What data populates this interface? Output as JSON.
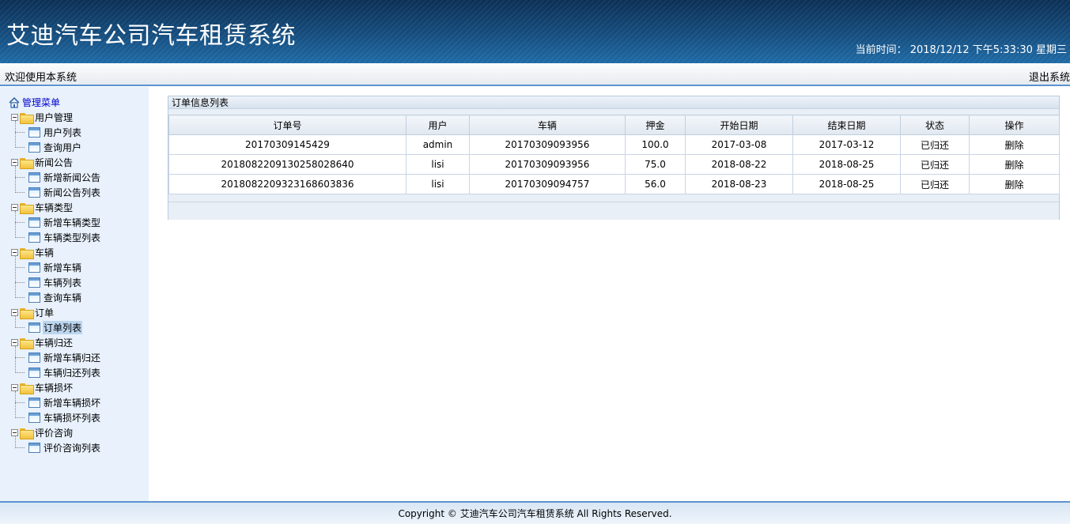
{
  "header": {
    "title": "艾迪汽车公司汽车租赁系统",
    "clock_label": "当前时间：",
    "clock_value": "2018/12/12 下午5:33:30 星期三"
  },
  "topbar": {
    "welcome": "欢迎使用本系统",
    "logout": "退出系统"
  },
  "sidebar": {
    "root_label": "管理菜单",
    "groups": [
      {
        "label": "用户管理",
        "items": [
          "用户列表",
          "查询用户"
        ]
      },
      {
        "label": "新闻公告",
        "items": [
          "新增新闻公告",
          "新闻公告列表"
        ]
      },
      {
        "label": "车辆类型",
        "items": [
          "新增车辆类型",
          "车辆类型列表"
        ]
      },
      {
        "label": "车辆",
        "items": [
          "新增车辆",
          "车辆列表",
          "查询车辆"
        ]
      },
      {
        "label": "订单",
        "items": [
          "订单列表"
        ]
      },
      {
        "label": "车辆归还",
        "items": [
          "新增车辆归还",
          "车辆归还列表"
        ]
      },
      {
        "label": "车辆损坏",
        "items": [
          "新增车辆损坏",
          "车辆损坏列表"
        ]
      },
      {
        "label": "评价咨询",
        "items": [
          "评价咨询列表"
        ]
      }
    ],
    "active_item": "订单列表"
  },
  "main": {
    "panel_title": "订单信息列表",
    "columns": [
      "订单号",
      "用户",
      "车辆",
      "押金",
      "开始日期",
      "结束日期",
      "状态",
      "操作"
    ],
    "rows": [
      [
        "20170309145429",
        "admin",
        "20170309093956",
        "100.0",
        "2017-03-08",
        "2017-03-12",
        "已归还",
        "删除"
      ],
      [
        "20180822091302580 28640",
        "lisi",
        "20170309093956",
        "75.0",
        "2018-08-22",
        "2018-08-25",
        "已归还",
        "删除"
      ],
      [
        "201808220932316 8603836",
        "lisi",
        "20170309094757",
        "56.0",
        "2018-08-23",
        "2018-08-25",
        "已归还",
        "删除"
      ]
    ]
  },
  "footer": {
    "copyright": "Copyright © 艾迪汽车公司汽车租赁系统 All Rights Reserved."
  }
}
